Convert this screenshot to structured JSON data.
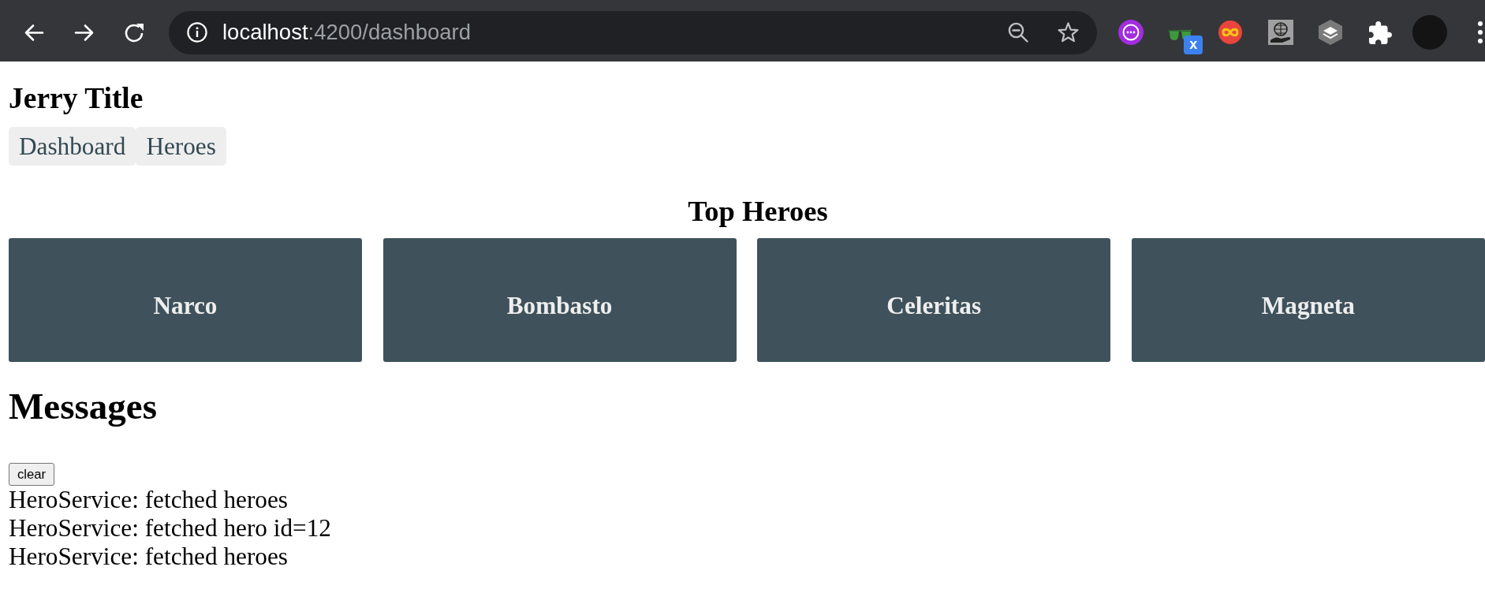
{
  "browser": {
    "address": {
      "host": "localhost",
      "path": ":4200/dashboard"
    },
    "extension_badge": "x"
  },
  "app": {
    "title": "Jerry Title",
    "nav": [
      {
        "label": "Dashboard"
      },
      {
        "label": "Heroes"
      }
    ]
  },
  "dashboard": {
    "heading": "Top Heroes",
    "heroes": [
      {
        "name": "Narco"
      },
      {
        "name": "Bombasto"
      },
      {
        "name": "Celeritas"
      },
      {
        "name": "Magneta"
      }
    ]
  },
  "messages": {
    "heading": "Messages",
    "clear_button": "clear",
    "items": [
      "HeroService: fetched heroes",
      "HeroService: fetched hero id=12",
      "HeroService: fetched heroes"
    ]
  }
}
